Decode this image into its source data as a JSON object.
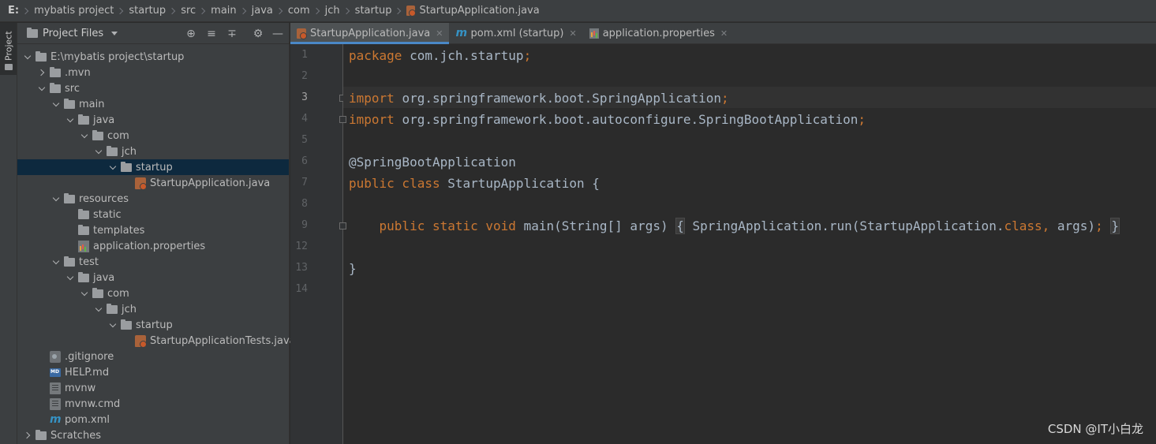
{
  "breadcrumb": {
    "items": [
      "E:",
      "mybatis project",
      "startup",
      "src",
      "main",
      "java",
      "com",
      "jch",
      "startup",
      "StartupApplication.java"
    ]
  },
  "tool_stripe": {
    "project_label": "Project"
  },
  "project_panel": {
    "title": "Project Files",
    "tree": [
      {
        "label": "E:\\mybatis project\\startup",
        "icon": "folder-icon",
        "expanded": true
      },
      {
        "label": ".mvn",
        "icon": "folder-icon",
        "expanded": false
      },
      {
        "label": "src",
        "icon": "folder-icon",
        "expanded": true
      },
      {
        "label": "main",
        "icon": "folder-icon",
        "expanded": true
      },
      {
        "label": "java",
        "icon": "folder-icon",
        "expanded": true
      },
      {
        "label": "com",
        "icon": "folder-icon",
        "expanded": true
      },
      {
        "label": "jch",
        "icon": "folder-icon",
        "expanded": true
      },
      {
        "label": "startup",
        "icon": "folder-icon",
        "expanded": true,
        "selected": true
      },
      {
        "label": "StartupApplication.java",
        "icon": "java-file-icon"
      },
      {
        "label": "resources",
        "icon": "folder-icon",
        "expanded": true
      },
      {
        "label": "static",
        "icon": "folder-icon"
      },
      {
        "label": "templates",
        "icon": "folder-icon"
      },
      {
        "label": "application.properties",
        "icon": "properties-file-icon"
      },
      {
        "label": "test",
        "icon": "folder-icon",
        "expanded": true
      },
      {
        "label": "java",
        "icon": "folder-icon",
        "expanded": true
      },
      {
        "label": "com",
        "icon": "folder-icon",
        "expanded": true
      },
      {
        "label": "jch",
        "icon": "folder-icon",
        "expanded": true
      },
      {
        "label": "startup",
        "icon": "folder-icon",
        "expanded": true
      },
      {
        "label": "StartupApplicationTests.java",
        "icon": "java-file-icon"
      },
      {
        "label": ".gitignore",
        "icon": "gitignore-file-icon"
      },
      {
        "label": "HELP.md",
        "icon": "markdown-file-icon"
      },
      {
        "label": "mvnw",
        "icon": "text-file-icon"
      },
      {
        "label": "mvnw.cmd",
        "icon": "text-file-icon"
      },
      {
        "label": "pom.xml",
        "icon": "maven-file-icon"
      },
      {
        "label": "Scratches",
        "icon": "folder-icon",
        "expanded": false
      }
    ]
  },
  "tabs": [
    {
      "label": "StartupApplication.java",
      "icon": "java-file-icon",
      "active": true
    },
    {
      "label": "pom.xml (startup)",
      "icon": "maven-file-icon",
      "active": false
    },
    {
      "label": "application.properties",
      "icon": "properties-file-icon",
      "active": false
    }
  ],
  "editor": {
    "current_line": 3,
    "lines": [
      {
        "num": "1",
        "tokens": [
          {
            "t": "package ",
            "c": "kw"
          },
          {
            "t": "com.jch.startup",
            "c": "plain"
          },
          {
            "t": ";",
            "c": "kw"
          }
        ]
      },
      {
        "num": "2",
        "tokens": []
      },
      {
        "num": "3",
        "tokens": [
          {
            "t": "import ",
            "c": "kw"
          },
          {
            "t": "org.springframework.boot.SpringApplication",
            "c": "plain"
          },
          {
            "t": ";",
            "c": "kw"
          }
        ]
      },
      {
        "num": "4",
        "tokens": [
          {
            "t": "import ",
            "c": "kw"
          },
          {
            "t": "org.springframework.boot.autoconfigure.SpringBootApplication",
            "c": "plain"
          },
          {
            "t": ";",
            "c": "kw"
          }
        ]
      },
      {
        "num": "5",
        "tokens": []
      },
      {
        "num": "6",
        "tokens": [
          {
            "t": "@SpringBootApplication",
            "c": "plain"
          }
        ]
      },
      {
        "num": "7",
        "tokens": [
          {
            "t": "public class ",
            "c": "kw"
          },
          {
            "t": "StartupApplication {",
            "c": "plain"
          }
        ]
      },
      {
        "num": "8",
        "tokens": []
      },
      {
        "num": "9",
        "tokens": [
          {
            "t": "    ",
            "c": "plain"
          },
          {
            "t": "public static void ",
            "c": "kw"
          },
          {
            "t": "main(String[] args)",
            "c": "plain"
          },
          {
            "t": " ",
            "c": "plain"
          },
          {
            "t": "{",
            "c": "brace"
          },
          {
            "t": " SpringApplication.run(StartupApplication.",
            "c": "plain"
          },
          {
            "t": "class",
            "c": "kw"
          },
          {
            "t": ", ",
            "c": "kw"
          },
          {
            "t": "args)",
            "c": "plain"
          },
          {
            "t": "; ",
            "c": "kw"
          },
          {
            "t": "}",
            "c": "brace"
          }
        ]
      },
      {
        "num": "12",
        "tokens": []
      },
      {
        "num": "13",
        "tokens": [
          {
            "t": "}",
            "c": "plain"
          }
        ]
      },
      {
        "num": "14",
        "tokens": []
      }
    ]
  },
  "watermark": "CSDN @IT小白龙",
  "colors": {
    "keyword": "#cc7832",
    "identifier": "#a9b7c6",
    "selection": "#0d293e",
    "active_tab_underline": "#4a88c7"
  }
}
